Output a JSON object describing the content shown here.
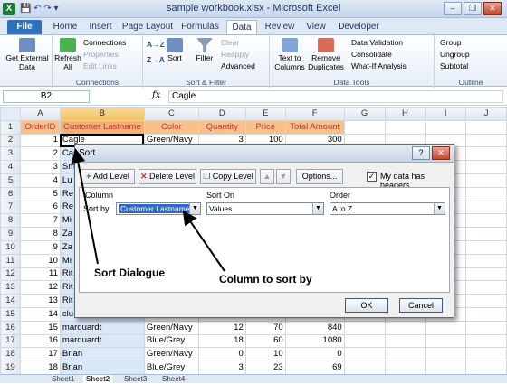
{
  "title": "sample workbook.xlsx - Microsoft Excel",
  "app_icon": "X",
  "qat_text": "💾 ↶ ↷ ▾",
  "window_buttons": [
    "–",
    "❐",
    "✕"
  ],
  "tabs": [
    "File",
    "Home",
    "Insert",
    "Page Layout",
    "Formulas",
    "Data",
    "Review",
    "View",
    "Developer"
  ],
  "ribbon": {
    "get_external": "Get External Data",
    "refresh": "Refresh All",
    "connections": "Connections",
    "properties": "Properties",
    "edit_links": "Edit Links",
    "connections_group": "Connections",
    "sort_az": "A→Z",
    "sort_za": "Z→A",
    "sort": "Sort",
    "filter": "Filter",
    "clear": "Clear",
    "reapply": "Reapply",
    "advanced": "Advanced",
    "sortfilter_group": "Sort & Filter",
    "text_to_columns": "Text to Columns",
    "remove_duplicates": "Remove Duplicates",
    "data_validation": "Data Validation",
    "consolidate": "Consolidate",
    "what_if": "What-If Analysis",
    "data_tools_group": "Data Tools",
    "group": "Group",
    "ungroup": "Ungroup",
    "subtotal": "Subtotal",
    "outline_group": "Outline"
  },
  "formula_bar": {
    "cell_ref": "B2",
    "fx": "fx",
    "value": "Cagle"
  },
  "sheet": {
    "columns": [
      "A",
      "B",
      "C",
      "D",
      "E",
      "F",
      "G",
      "H",
      "I",
      "J"
    ],
    "rows": [
      [
        "OrderID",
        "Customer Lastname",
        "Color",
        "Quantity",
        "Price",
        "Total Amount"
      ],
      [
        "1",
        "Cagle",
        "Green/Navy",
        "3",
        "100",
        "300"
      ],
      [
        "2",
        "Cagle",
        "",
        "",
        "",
        ""
      ],
      [
        "3",
        "Sm",
        "",
        "",
        "",
        ""
      ],
      [
        "4",
        "Lu",
        "",
        "",
        "",
        ""
      ],
      [
        "5",
        "Re",
        "",
        "",
        "",
        ""
      ],
      [
        "6",
        "Re",
        "",
        "",
        "",
        ""
      ],
      [
        "7",
        "Mi",
        "",
        "",
        "",
        ""
      ],
      [
        "8",
        "Za",
        "",
        "",
        "",
        ""
      ],
      [
        "9",
        "Za",
        "",
        "",
        "",
        ""
      ],
      [
        "10",
        "Mi",
        "",
        "",
        "",
        ""
      ],
      [
        "11",
        "Rit",
        "",
        "",
        "",
        ""
      ],
      [
        "12",
        "Rit",
        "",
        "",
        "",
        ""
      ],
      [
        "13",
        "Rit",
        "",
        "",
        "",
        ""
      ],
      [
        "14",
        "clu",
        "",
        "",
        "",
        ""
      ],
      [
        "15",
        "marquardt",
        "Green/Navy",
        "12",
        "70",
        "840"
      ],
      [
        "16",
        "marquardt",
        "Blue/Grey",
        "18",
        "60",
        "1080"
      ],
      [
        "17",
        "Brian",
        "Green/Navy",
        "0",
        "10",
        "0"
      ],
      [
        "18",
        "Brian",
        "Blue/Grey",
        "3",
        "23",
        "69"
      ],
      [
        "19",
        "Cordova",
        "Green/Navy",
        "6",
        "25",
        "150"
      ]
    ]
  },
  "sheet_tabs": [
    "Sheet1",
    "Sheet2",
    "Sheet3",
    "Sheet4"
  ],
  "dialog": {
    "title": "Sort",
    "help": "?",
    "close": "✕",
    "add_level": "Add Level",
    "delete_level": "Delete Level",
    "copy_level": "Copy Level",
    "move_up": "▲",
    "move_down": "▼",
    "options": "Options...",
    "header_check": "✓",
    "header_label": "My data has headers",
    "col_header": "Column",
    "sort_on_header": "Sort On",
    "order_header": "Order",
    "sort_by": "Sort by",
    "column_value": "Customer Lastname",
    "sort_on_value": "Values",
    "order_value": "A to Z",
    "ok": "OK",
    "cancel": "Cancel"
  },
  "annotations": {
    "sort_dialogue": "Sort Dialogue",
    "column_to_sort": "Column to sort by"
  }
}
